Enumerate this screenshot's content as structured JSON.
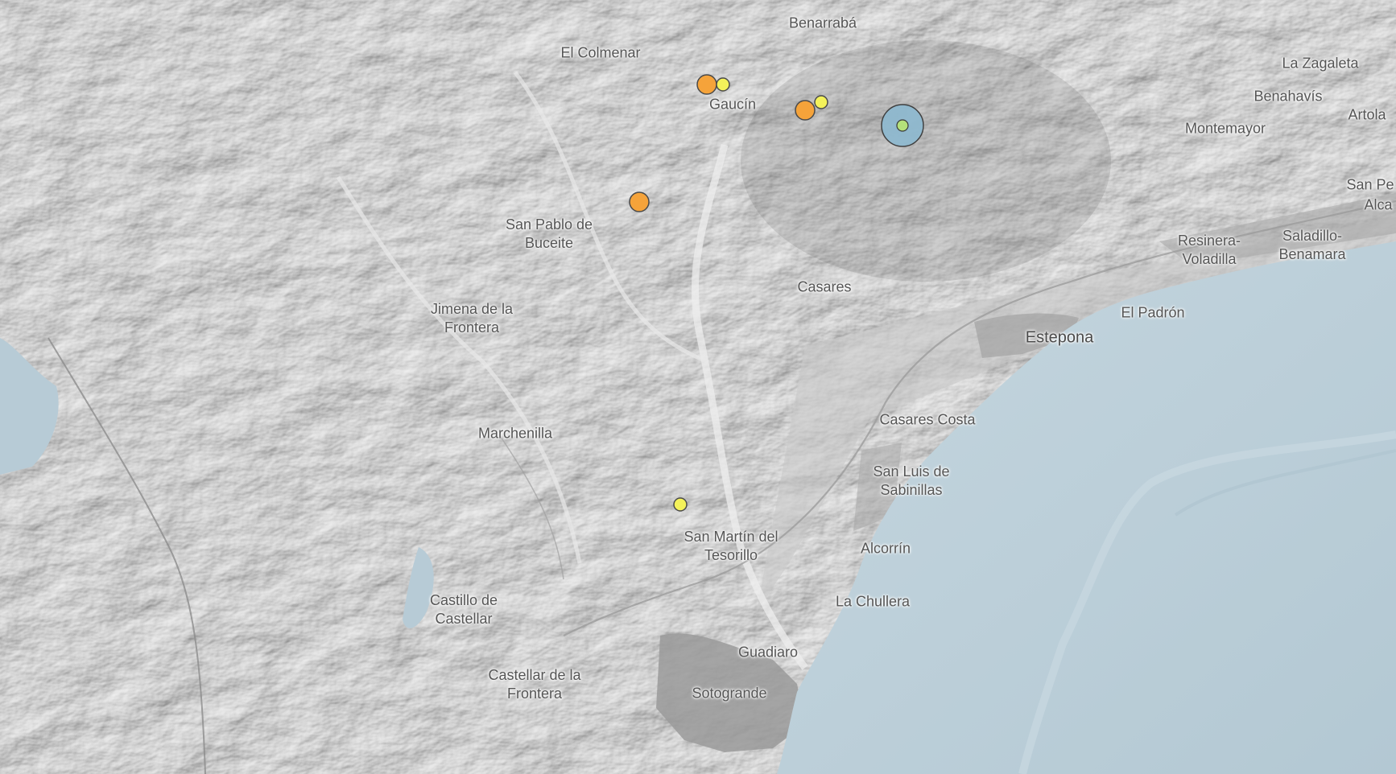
{
  "colors": {
    "sea": "#b9ccd6",
    "land": "#d4d4d4",
    "urban": "#9a9a9a",
    "marker_orange": "#f5a33a",
    "marker_yellow": "#f4f25a",
    "marker_main_outer": "#8fb9cf",
    "marker_main_inner": "#b4e07a",
    "label": "#555555"
  },
  "places": [
    {
      "id": "benarraba",
      "lines": [
        "Benarrabá"
      ]
    },
    {
      "id": "el-colmenar",
      "lines": [
        "El Colmenar"
      ]
    },
    {
      "id": "gaucin",
      "lines": [
        "Gaucín"
      ]
    },
    {
      "id": "la-zagaleta",
      "lines": [
        "La Zagaleta"
      ]
    },
    {
      "id": "benahavis",
      "lines": [
        "Benahavís"
      ]
    },
    {
      "id": "artola",
      "lines": [
        "Artola"
      ]
    },
    {
      "id": "montemayor",
      "lines": [
        "Montemayor"
      ]
    },
    {
      "id": "san-pe",
      "lines": [
        "San Pe"
      ]
    },
    {
      "id": "alca",
      "lines": [
        "Alca"
      ]
    },
    {
      "id": "san-pablo",
      "lines": [
        "San Pablo de",
        "Buceite"
      ]
    },
    {
      "id": "resinera",
      "lines": [
        "Resinera-",
        "Voladilla"
      ]
    },
    {
      "id": "saladillo",
      "lines": [
        "Saladillo-",
        "Benamara"
      ]
    },
    {
      "id": "casares",
      "lines": [
        "Casares"
      ]
    },
    {
      "id": "jimena",
      "lines": [
        "Jimena de la",
        "Frontera"
      ]
    },
    {
      "id": "el-padron",
      "lines": [
        "El Padrón"
      ]
    },
    {
      "id": "estepona",
      "lines": [
        "Estepona"
      ]
    },
    {
      "id": "casares-costa",
      "lines": [
        "Casares Costa"
      ]
    },
    {
      "id": "marchenilla",
      "lines": [
        "Marchenilla"
      ]
    },
    {
      "id": "san-luis",
      "lines": [
        "San Luis de",
        "Sabinillas"
      ]
    },
    {
      "id": "san-martin",
      "lines": [
        "San Martín del",
        "Tesorillo"
      ]
    },
    {
      "id": "alcorrin",
      "lines": [
        "Alcorrín"
      ]
    },
    {
      "id": "castillo",
      "lines": [
        "Castillo de",
        "Castellar"
      ]
    },
    {
      "id": "la-chullera",
      "lines": [
        "La Chullera"
      ]
    },
    {
      "id": "guadiaro",
      "lines": [
        "Guadiaro"
      ]
    },
    {
      "id": "castellar",
      "lines": [
        "Castellar de la",
        "Frontera"
      ]
    },
    {
      "id": "sotogrande",
      "lines": [
        "Sotogrande"
      ]
    }
  ],
  "markers": [
    {
      "id": "quake-1",
      "level": "orange",
      "icon": "earthquake-marker"
    },
    {
      "id": "quake-2",
      "level": "yellow",
      "icon": "earthquake-marker"
    },
    {
      "id": "quake-3",
      "level": "orange",
      "icon": "earthquake-marker"
    },
    {
      "id": "quake-4",
      "level": "yellow",
      "icon": "earthquake-marker"
    },
    {
      "id": "quake-5",
      "level": "orange",
      "icon": "earthquake-marker"
    },
    {
      "id": "quake-6",
      "level": "yellow",
      "icon": "earthquake-marker"
    },
    {
      "id": "quake-main",
      "level": "main",
      "icon": "epicenter-marker"
    }
  ]
}
